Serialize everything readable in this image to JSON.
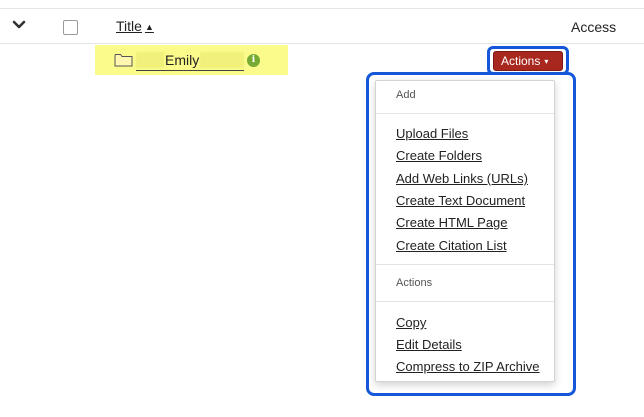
{
  "table_header": {
    "title_label": "Title",
    "sort_icon": "▲",
    "access_label": "Access"
  },
  "file_row": {
    "name": "Emily",
    "info_icon": "i"
  },
  "actions_button": {
    "label": "Actions",
    "caret": "▾",
    "color": "#a8271f"
  },
  "dropdown": {
    "add_section": {
      "label": "Add",
      "items": [
        "Upload Files",
        "Create Folders",
        "Add Web Links (URLs)",
        "Create Text Document",
        "Create HTML Page",
        "Create Citation List"
      ]
    },
    "actions_section": {
      "label": "Actions",
      "items": [
        "Copy",
        "Edit Details",
        "Compress to ZIP Archive"
      ]
    }
  },
  "colors": {
    "highlight": "#fbfb8c",
    "annotation_outline": "#1557d8"
  }
}
